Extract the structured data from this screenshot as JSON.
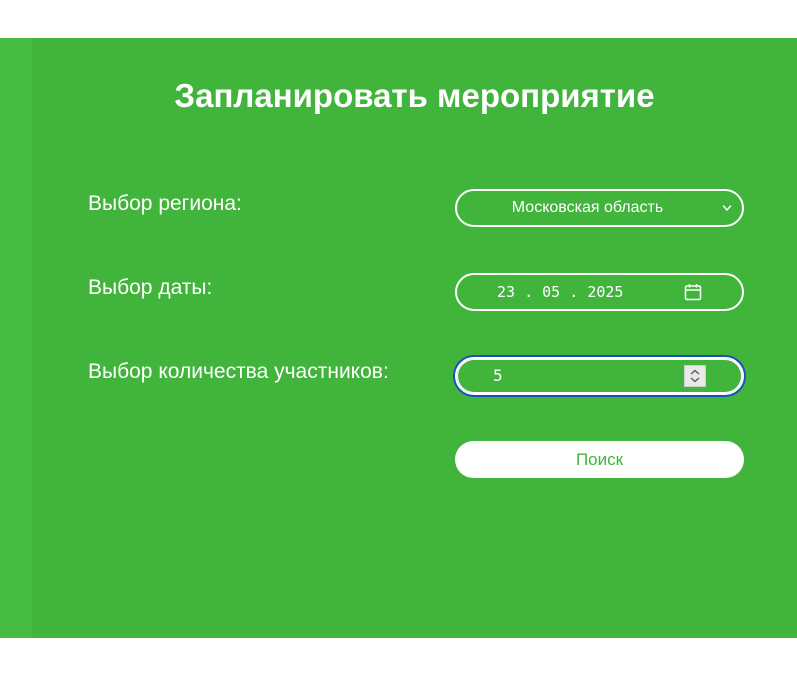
{
  "form": {
    "title": "Запланировать мероприятие",
    "region": {
      "label": "Выбор региона:",
      "selected": "Московская область",
      "icon": "chevron-down-icon"
    },
    "date": {
      "label": "Выбор даты:",
      "value": "23.05.2025",
      "day": "23",
      "month": "05",
      "year": "2025",
      "icon": "calendar-icon"
    },
    "participants": {
      "label": "Выбор количества участников:",
      "value": "5",
      "icon": "spinner-icon"
    },
    "search_label": "Поиск"
  },
  "colors": {
    "background": "#41b43c",
    "text": "#ffffff",
    "focus_ring": "#1a4fbf"
  }
}
